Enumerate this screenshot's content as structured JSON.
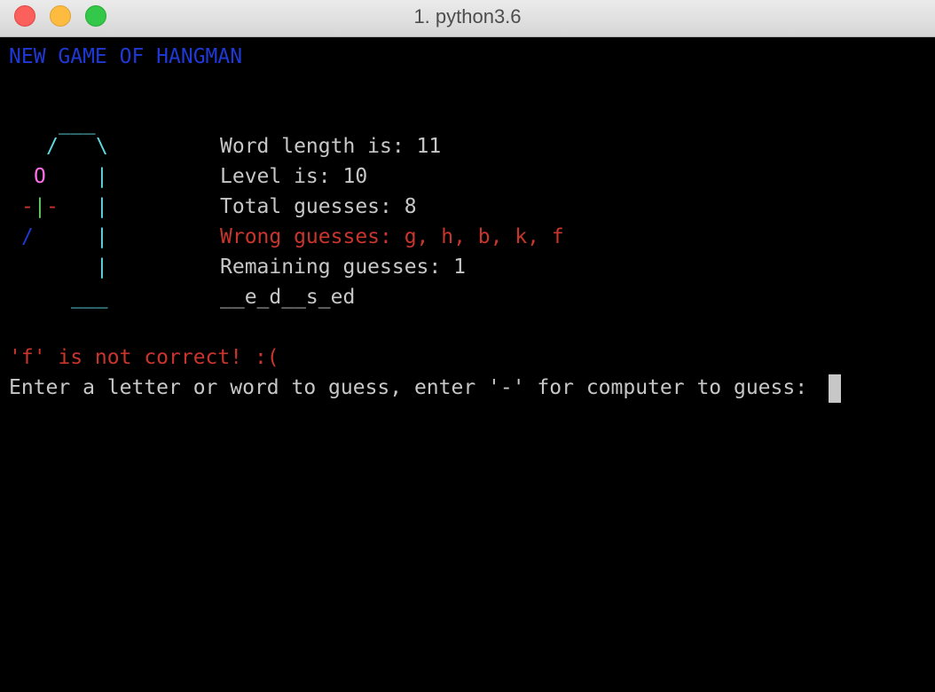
{
  "window": {
    "title": "1. python3.6"
  },
  "terminal": {
    "header": "NEW GAME OF HANGMAN",
    "gallows": {
      "top": "___",
      "left_slash": "/",
      "right_backslash": "\\",
      "head": "O",
      "arm_left": "-",
      "torso": "|",
      "arm_right": "-",
      "leg_left": "/",
      "post": "|",
      "base": "___"
    },
    "info": {
      "word_length": "Word length is: 11",
      "level": "Level is: 10",
      "total_guesses": "Total guesses: 8",
      "wrong_guesses": "Wrong guesses: g, h, b, k, f",
      "remaining_guesses": "Remaining guesses: 1",
      "word_pattern": "__e_d__s_ed"
    },
    "message": "'f' is not correct! :(",
    "prompt": "Enter a letter or word to guess, enter '-' for computer to guess: "
  },
  "colors": {
    "header": "#1f38d6",
    "error": "#c9352c",
    "gallows": "#5fd7e0",
    "head": "#ff6ee6",
    "torso": "#64c863",
    "text": "#c7c7c7"
  }
}
